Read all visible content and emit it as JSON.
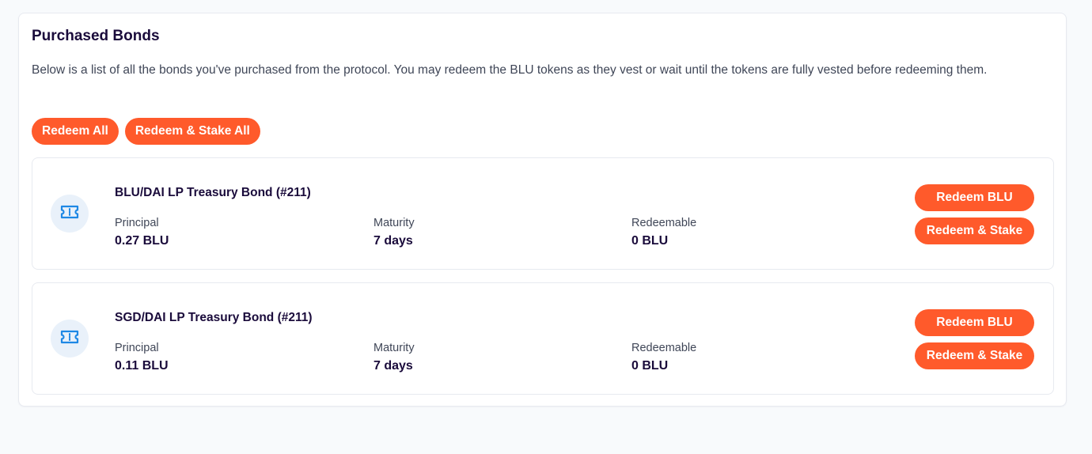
{
  "panel": {
    "title": "Purchased Bonds",
    "description": "Below is a list of all the bonds you've purchased from the protocol. You may redeem the BLU tokens as they vest or wait until the tokens are fully vested before redeeming them."
  },
  "actions": {
    "redeem_all": "Redeem All",
    "redeem_stake_all": "Redeem & Stake All"
  },
  "labels": {
    "principal": "Principal",
    "maturity": "Maturity",
    "redeemable": "Redeemable",
    "redeem_button": "Redeem BLU",
    "redeem_stake_button": "Redeem & Stake"
  },
  "bonds": [
    {
      "name": "BLU/DAI LP Treasury Bond (#211)",
      "principal": "0.27 BLU",
      "maturity": "7 days",
      "redeemable": "0 BLU",
      "icon": "ticket-icon"
    },
    {
      "name": "SGD/DAI LP Treasury Bond (#211)",
      "principal": "0.11 BLU",
      "maturity": "7 days",
      "redeemable": "0 BLU",
      "icon": "ticket-icon"
    }
  ],
  "colors": {
    "accent": "#ff5a2b",
    "icon": "#1e88e5",
    "icon_bg": "#e9f1fa"
  }
}
